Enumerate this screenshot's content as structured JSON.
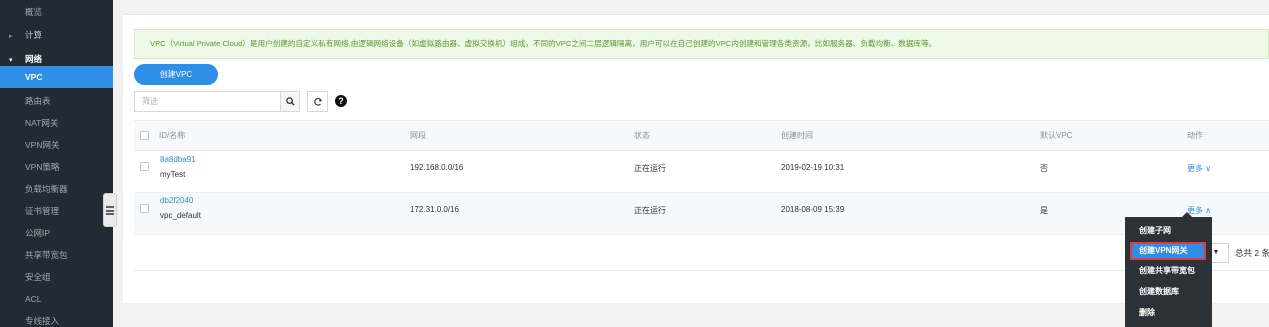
{
  "sidebar": {
    "items": [
      {
        "label": "概览"
      },
      {
        "label": "计算",
        "caret": "▸"
      },
      {
        "label": "网络",
        "caret": "▾"
      },
      {
        "label": "VPC"
      },
      {
        "label": "路由表"
      },
      {
        "label": "NAT网关"
      },
      {
        "label": "VPN网关"
      },
      {
        "label": "VPN策略"
      },
      {
        "label": "负载均衡器"
      },
      {
        "label": "证书管理"
      },
      {
        "label": "公网IP"
      },
      {
        "label": "共享带宽包"
      },
      {
        "label": "安全组"
      },
      {
        "label": "ACL"
      },
      {
        "label": "专线接入"
      }
    ]
  },
  "banner": {
    "text": "VPC（Virtual Private Cloud）是用户创建的自定义私有网络,由逻辑网络设备（如虚拟路由器、虚拟交换机）组成，不同的VPC之间二层逻辑隔离，用户可以在自己创建的VPC内创建和管理各类资源，比如服务器、负载均衡、数据库等。"
  },
  "toolbar": {
    "create_label": "创建VPC",
    "search_placeholder": "筛选",
    "help_glyph": "?"
  },
  "table": {
    "headers": {
      "id_name": "ID/名称",
      "cidr": "网段",
      "status": "状态",
      "created": "创建时间",
      "default_vpc": "默认VPC",
      "actions": "动作"
    },
    "rows": [
      {
        "id": "8a8dba91",
        "name": "myTest",
        "cidr": "192.168.0.0/16",
        "status": "正在运行",
        "created": "2019-02-19 10:31",
        "default": "否",
        "more": "更多 ∨"
      },
      {
        "id": "db2f2040",
        "name": "vpc_default",
        "cidr": "172.31.0.0/16",
        "status": "正在运行",
        "created": "2018-08-09 15:39",
        "default": "是",
        "more": "更多 ∧"
      }
    ]
  },
  "pagination": {
    "page_size_caret": "▼",
    "total": "总共 2 条"
  },
  "dropdown": {
    "items": [
      {
        "label": "创建子网"
      },
      {
        "label": "创建VPN网关"
      },
      {
        "label": "创建共享带宽包"
      },
      {
        "label": "创建数据库"
      },
      {
        "label": "删除"
      }
    ]
  },
  "colors": {
    "sidebar_bg": "#222b33",
    "accent": "#2f8fe8",
    "banner_bg": "#edf8e6",
    "banner_text": "#5a9a2e",
    "highlight_border": "#e23b3b"
  }
}
